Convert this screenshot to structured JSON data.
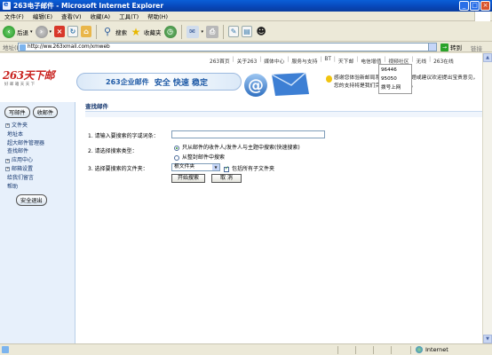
{
  "window": {
    "title": "263电子邮件 - Microsoft Internet Explorer",
    "minimize": "_",
    "maximize": "□",
    "close": "×"
  },
  "menu": [
    "文件(F)",
    "编辑(E)",
    "查看(V)",
    "收藏(A)",
    "工具(T)",
    "帮助(H)"
  ],
  "toolbar": {
    "back": "后退",
    "forward_glyph": "›",
    "back_glyph": "‹",
    "stop_glyph": "×",
    "search": "搜索",
    "favorites": "收藏夹"
  },
  "address": {
    "label": "地址(D)",
    "url": "http://ww.263xmail.com/xmweb",
    "go": "转到",
    "links": "链接"
  },
  "top_links": [
    "263首页",
    "关于263",
    "媒体中心",
    "服务与支持",
    "BT",
    "天下邮",
    "电信增值",
    "视频社区",
    "无线",
    "263在线"
  ],
  "popup_items": [
    "96446",
    "95050",
    "拨号上网"
  ],
  "banner": {
    "logo": "263天下邮",
    "logo_sub": "好 邮 箱 天 天 下",
    "product": "263企业邮件",
    "slogan": "安全 快速 稳定",
    "notice": "感谢您体验新邮局系统，有任何问题或建议欢迎提出宝贵意见，您的支持将是我们完善产品的动力。"
  },
  "sidebar": {
    "compose": "写邮件",
    "inbox": "收邮件",
    "items": [
      {
        "label": "文件夹",
        "expandable": true
      },
      {
        "label": "地址本",
        "expandable": false
      },
      {
        "label": "超大邮件管理器",
        "expandable": false
      },
      {
        "label": "查找邮件",
        "expandable": false
      },
      {
        "label": "应用中心",
        "expandable": true
      },
      {
        "label": "邮箱设置",
        "expandable": true
      },
      {
        "label": "给我们留言",
        "expandable": false
      },
      {
        "label": "帮助",
        "expandable": false
      }
    ],
    "logout": "安全退出",
    "plus": "+"
  },
  "main": {
    "heading": "查找邮件",
    "q1": "1. 请输入要搜索的字或词条：",
    "q1_value": "",
    "q2": "2. 请选择搜索类型：",
    "opt1": "只从邮件的收件人/发件人与主题中搜索(快速搜索)",
    "opt2": "从整封邮件中搜索",
    "q3": "3. 选择要搜索的文件夹：",
    "folder_value": "根文件夹",
    "include_sub": "包括所有子文件夹",
    "search_btn": "开始搜索",
    "cancel_btn": "取 消"
  },
  "status": {
    "zone": "Internet"
  }
}
